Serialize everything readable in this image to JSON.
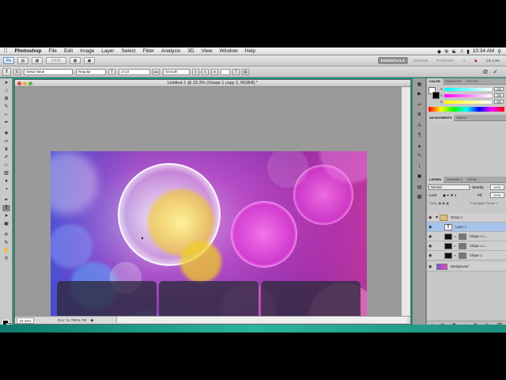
{
  "menubar": {
    "app": "Photoshop",
    "items": [
      "File",
      "Edit",
      "Image",
      "Layer",
      "Select",
      "Filter",
      "Analysis",
      "3D",
      "View",
      "Window",
      "Help"
    ],
    "clock": "10:34 AM"
  },
  "appbar": {
    "ps_logo": "Ps",
    "zoom": "100%",
    "workspaces": [
      "ESSENTIALS",
      "DESIGN",
      "PAINTING"
    ],
    "cs_live": "CS Live"
  },
  "options": {
    "font_family": "Sekai Neue",
    "font_style": "Regular",
    "font_size": "24 pt",
    "antialias": "Smooth"
  },
  "document": {
    "title": "Untitled-1 @ 33.3% (Shape 1 copy 2, RGB/8) *",
    "zoom": "33.33%",
    "doc_size": "Doc: 11.7M/11.7M"
  },
  "color_panel": {
    "tabs": [
      "COLOR",
      "SWATCHES",
      "STYLES"
    ],
    "r": "255",
    "g": "255",
    "b": "255"
  },
  "adjust_tabs": [
    "ADJUSTMENTS",
    "MASKS"
  ],
  "layers_panel": {
    "tabs": [
      "LAYERS",
      "CHANNELS",
      "PATHS"
    ],
    "blend_mode": "Normal",
    "opacity_label": "Opacity:",
    "opacity": "100%",
    "fill_label": "Fill:",
    "fill": "100%",
    "lock_label": "Lock:",
    "propagate": "Propagate Frame 1",
    "layers": [
      {
        "name": "Group 1",
        "kind": "group"
      },
      {
        "name": "Layer 1",
        "kind": "text"
      },
      {
        "name": "Shape 1 c...",
        "kind": "shape"
      },
      {
        "name": "Shape 1 c...",
        "kind": "shape"
      },
      {
        "name": "Shape 1",
        "kind": "shape"
      },
      {
        "name": "Background",
        "kind": "image"
      }
    ]
  },
  "colors": {
    "selection": "#a7c4ec",
    "workspace": "#9a9a9a"
  }
}
